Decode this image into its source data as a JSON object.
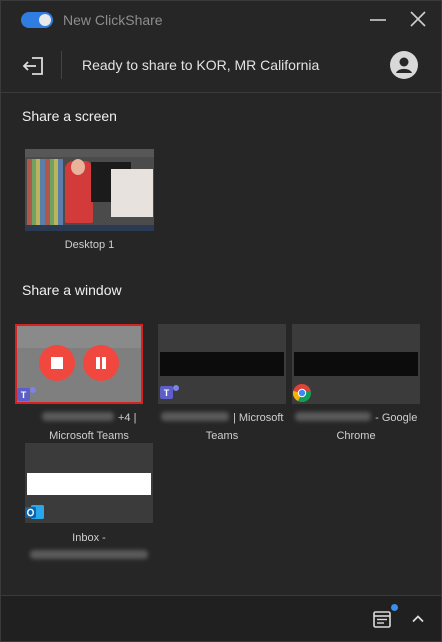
{
  "window": {
    "title": "New ClickShare"
  },
  "header": {
    "status": "Ready to share to KOR, MR California"
  },
  "sections": {
    "screen_title": "Share a screen",
    "window_title": "Share a window"
  },
  "screens": [
    {
      "label": "Desktop 1"
    }
  ],
  "windows": [
    {
      "app": "Microsoft Teams",
      "caption_suffix": "+4 |",
      "caption_line2": "Microsoft Teams",
      "selected": true,
      "icon": "teams-icon"
    },
    {
      "app": "Microsoft Teams",
      "caption_suffix": "| Microsoft",
      "caption_line2": "Teams",
      "selected": false,
      "icon": "teams-icon"
    },
    {
      "app": "Google Chrome",
      "caption_suffix": "- Google",
      "caption_line2": "Chrome",
      "selected": false,
      "icon": "chrome-icon"
    },
    {
      "app": "Outlook",
      "caption_prefix": "Inbox -",
      "selected": false,
      "icon": "outlook-icon"
    }
  ],
  "colors": {
    "accent": "#2f7de1",
    "stop": "#f0473f",
    "selection": "#d72222",
    "notification": "#3b8df1"
  }
}
